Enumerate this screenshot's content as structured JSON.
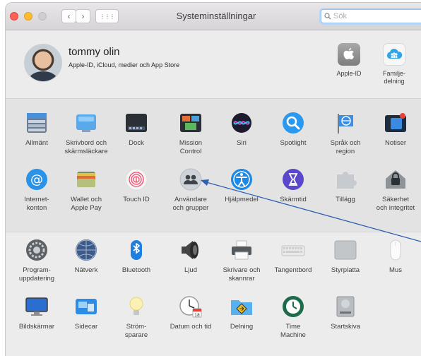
{
  "window": {
    "title": "Systeminställningar"
  },
  "toolbar": {
    "back_glyph": "‹",
    "forward_glyph": "›",
    "grid_glyph": "⋮⋮⋮",
    "search_placeholder": "Sök"
  },
  "account": {
    "name": "tommy olin",
    "subtitle": "Apple-ID, iCloud, medier och App Store",
    "items": [
      {
        "label": "Apple-ID",
        "icon": "apple-icon"
      },
      {
        "label": "Familje-\ndelning",
        "icon": "family-icon"
      }
    ]
  },
  "rows": [
    [
      {
        "label": "Allmänt",
        "icon": "general-icon"
      },
      {
        "label": "Skrivbord och\nskärmsläckare",
        "icon": "desktop-icon"
      },
      {
        "label": "Dock",
        "icon": "dock-icon"
      },
      {
        "label": "Mission\nControl",
        "icon": "mission-control-icon"
      },
      {
        "label": "Siri",
        "icon": "siri-icon"
      },
      {
        "label": "Spotlight",
        "icon": "spotlight-icon"
      },
      {
        "label": "Språk och\nregion",
        "icon": "language-icon"
      },
      {
        "label": "Notiser",
        "icon": "notifications-icon"
      }
    ],
    [
      {
        "label": "Internet-\nkonton",
        "icon": "internet-accounts-icon"
      },
      {
        "label": "Wallet och\nApple Pay",
        "icon": "wallet-icon"
      },
      {
        "label": "Touch ID",
        "icon": "touch-id-icon"
      },
      {
        "label": "Användare\noch grupper",
        "icon": "users-icon"
      },
      {
        "label": "Hjälpmedel",
        "icon": "accessibility-icon"
      },
      {
        "label": "Skärmtid",
        "icon": "screen-time-icon"
      },
      {
        "label": "Tillägg",
        "icon": "extensions-icon"
      },
      {
        "label": "Säkerhet\noch integritet",
        "icon": "security-icon"
      }
    ],
    [
      {
        "label": "Program-\nuppdatering",
        "icon": "software-update-icon"
      },
      {
        "label": "Nätverk",
        "icon": "network-icon"
      },
      {
        "label": "Bluetooth",
        "icon": "bluetooth-icon"
      },
      {
        "label": "Ljud",
        "icon": "sound-icon"
      },
      {
        "label": "Skrivare och\nskannrar",
        "icon": "printer-icon"
      },
      {
        "label": "Tangentbord",
        "icon": "keyboard-icon"
      },
      {
        "label": "Styrplatta",
        "icon": "trackpad-icon"
      },
      {
        "label": "Mus",
        "icon": "mouse-icon"
      }
    ],
    [
      {
        "label": "Bildskärmar",
        "icon": "displays-icon"
      },
      {
        "label": "Sidecar",
        "icon": "sidecar-icon"
      },
      {
        "label": "Ström-\nsparare",
        "icon": "energy-saver-icon"
      },
      {
        "label": "Datum och tid",
        "icon": "date-time-icon"
      },
      {
        "label": "Delning",
        "icon": "sharing-icon"
      },
      {
        "label": "Time\nMachine",
        "icon": "time-machine-icon"
      },
      {
        "label": "Startskiva",
        "icon": "startup-disk-icon"
      }
    ]
  ],
  "colors": {
    "accent_arrow": "#2f5fb3",
    "search_focus": "#9ec3ea"
  }
}
